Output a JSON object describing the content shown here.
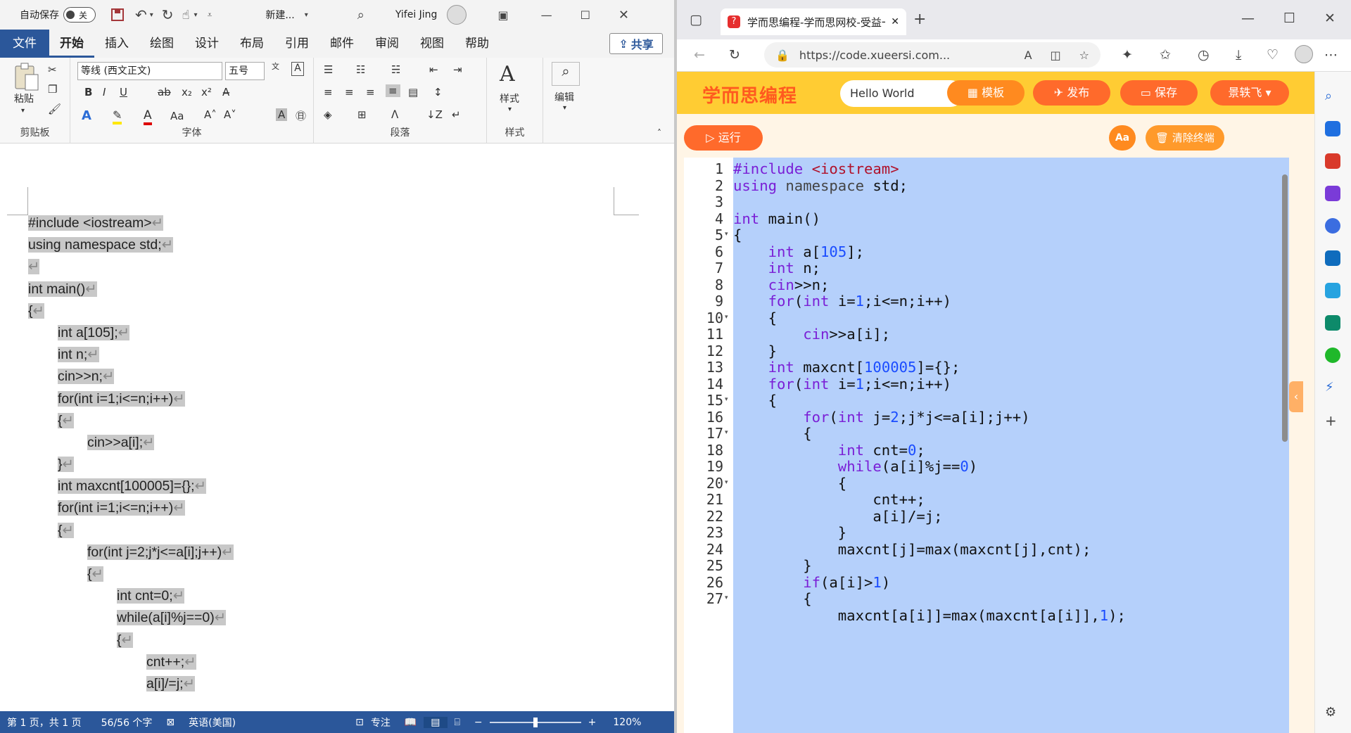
{
  "word": {
    "titlebar": {
      "autosave_label": "自动保存",
      "autosave_state": "关",
      "doc_name": "新建...",
      "user_name": "Yifei Jing"
    },
    "tabs": [
      "文件",
      "开始",
      "插入",
      "绘图",
      "设计",
      "布局",
      "引用",
      "邮件",
      "审阅",
      "视图",
      "帮助"
    ],
    "share_label": "共享",
    "ribbon": {
      "paste_label": "粘贴",
      "clipboard_label": "剪贴板",
      "font_name": "等线 (西文正文)",
      "font_size": "五号",
      "font_group_label": "字体",
      "paragraph_label": "段落",
      "styles_label": "样式",
      "styles_btn": "样式",
      "edit_btn": "编辑"
    },
    "doc_lines": [
      "#include <iostream>",
      "using namespace std;",
      "",
      "int main()",
      "{",
      "    int a[105];",
      "    int n;",
      "    cin>>n;",
      "    for(int i=1;i<=n;i++)",
      "    {",
      "        cin>>a[i];",
      "    }",
      "    int maxcnt[100005]={};",
      "    for(int i=1;i<=n;i++)",
      "    {",
      "        for(int j=2;j*j<=a[i];j++)",
      "        {",
      "            int cnt=0;",
      "            while(a[i]%j==0)",
      "            {",
      "                cnt++;",
      "                a[i]/=j;"
    ],
    "status": {
      "page": "第 1 页，共 1 页",
      "words": "56/56 个字",
      "language": "英语(美国)",
      "focus": "专注",
      "zoom": "120%"
    }
  },
  "edge": {
    "tab_title": "学而思编程-学而思网校-受益一生",
    "url": "https://code.xueersi.com...",
    "site": {
      "logo": "学而思编程",
      "project_name": "Hello World",
      "template_btn": "模板",
      "publish_btn": "发布",
      "save_btn": "保存",
      "user_btn": "景轶飞",
      "run_btn": "运行",
      "font_btn": "Aa",
      "clear_btn": "清除终端"
    },
    "code_lines": [
      "#include <iostream>",
      "using namespace std;",
      "",
      "int main()",
      "{",
      "    int a[105];",
      "    int n;",
      "    cin>>n;",
      "    for(int i=1;i<=n;i++)",
      "    {",
      "        cin>>a[i];",
      "    }",
      "    int maxcnt[100005]={};",
      "    for(int i=1;i<=n;i++)",
      "    {",
      "        for(int j=2;j*j<=a[i];j++)",
      "        {",
      "            int cnt=0;",
      "            while(a[i]%j==0)",
      "            {",
      "                cnt++;",
      "                a[i]/=j;",
      "            }",
      "            maxcnt[j]=max(maxcnt[j],cnt);",
      "        }",
      "        if(a[i]>1)",
      "        {"
    ],
    "fold_lines": [
      5,
      10,
      15,
      17,
      20,
      27
    ],
    "code_last_partial": "            maxcnt[a[i]]=max(maxcnt[a[i]],1);"
  }
}
